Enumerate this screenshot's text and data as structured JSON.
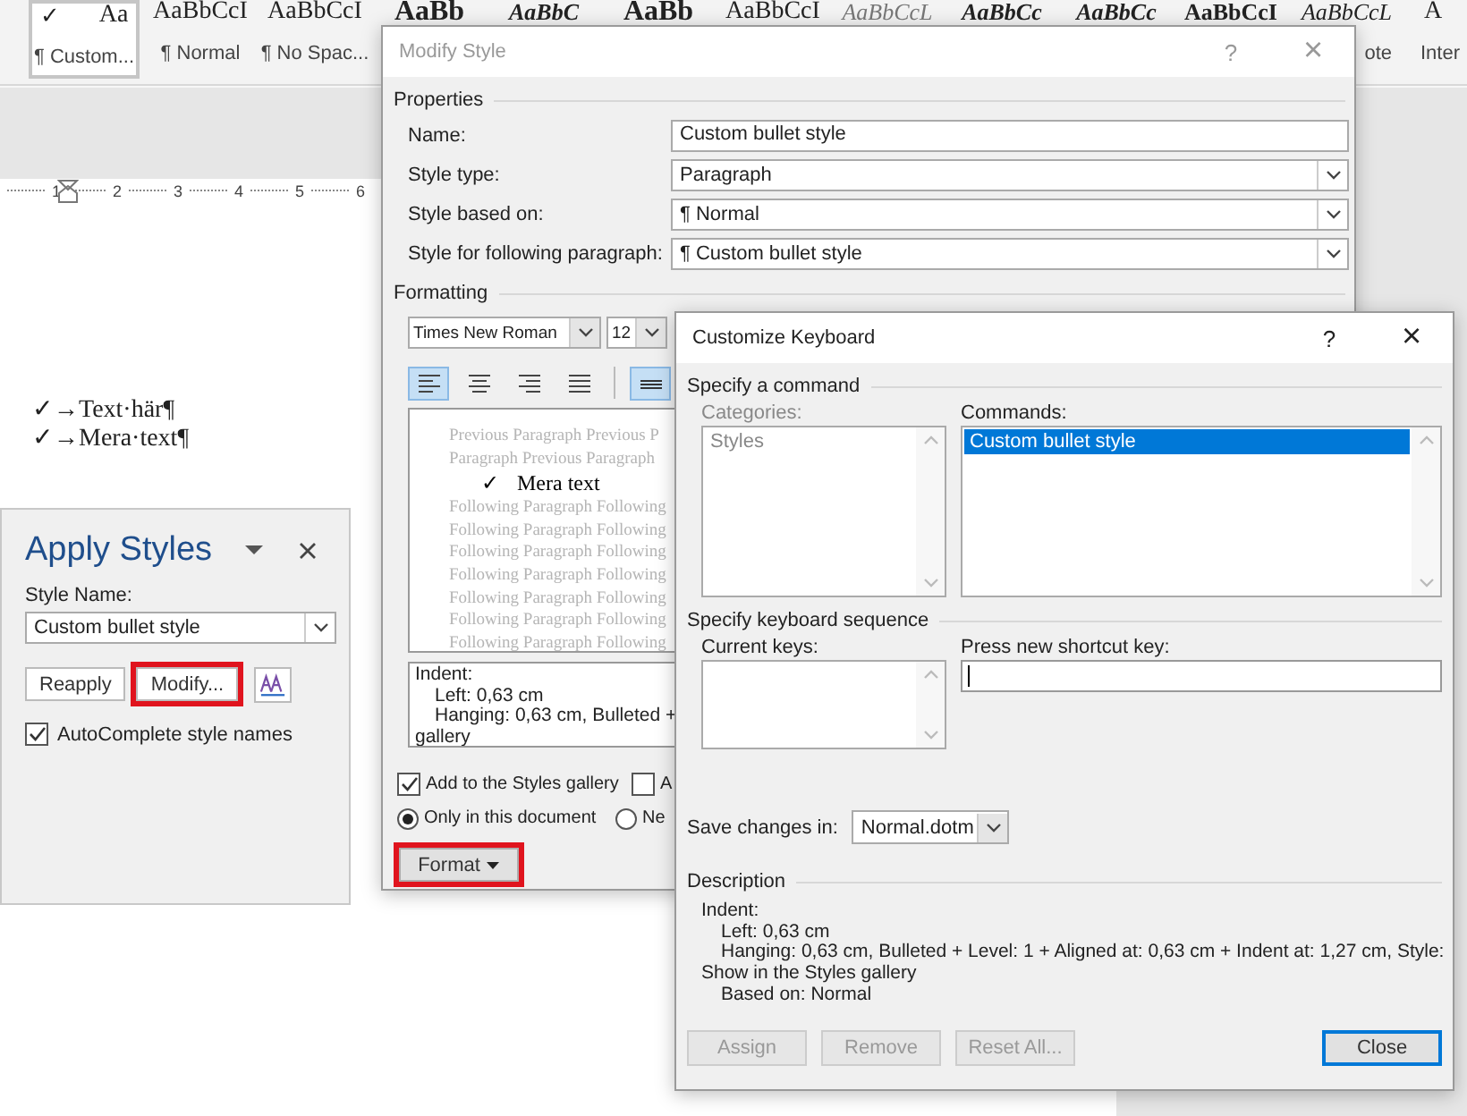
{
  "ribbon": {
    "gallery": [
      {
        "check": "✓",
        "preview": "Aa",
        "label": "¶ Custom...",
        "kind": "plain",
        "selected": true
      },
      {
        "preview": "AaBbCcI",
        "label": "¶ Normal",
        "kind": "plain",
        "selected": false
      },
      {
        "preview": "AaBbCcI",
        "label": "¶ No Spac...",
        "kind": "plain",
        "selected": false
      },
      {
        "preview": "AaBb",
        "kind": "heading",
        "selected": false
      },
      {
        "preview": "AaBbC",
        "kind": "bold-italic",
        "selected": false
      },
      {
        "preview": "AaBb",
        "kind": "heading",
        "selected": false
      },
      {
        "preview": "AaBbCcI",
        "kind": "plain",
        "selected": false
      },
      {
        "preview": "AaBbCcL",
        "kind": "subtle",
        "selected": false
      },
      {
        "preview": "AaBbCc",
        "kind": "bold-italic",
        "selected": false
      },
      {
        "preview": "AaBbCc",
        "kind": "bold-italic",
        "selected": false
      },
      {
        "preview": "AaBbCcI",
        "kind": "bold",
        "selected": false
      },
      {
        "preview": "AaBbCcL",
        "label": "ote",
        "kind": "italic",
        "selected": false
      },
      {
        "preview": "A",
        "label": "Inter",
        "kind": "plain",
        "selected": false
      }
    ]
  },
  "ruler": {
    "numbers": [
      "1",
      "2",
      "3",
      "4",
      "5",
      "6"
    ]
  },
  "document": {
    "lines": [
      "✓→Text·här¶",
      "✓→Mera·text¶"
    ]
  },
  "apply_styles": {
    "title": "Apply Styles",
    "style_name_label": "Style Name:",
    "style_name": "Custom bullet style",
    "buttons": [
      {
        "label": "Reapply",
        "highlighted": false
      },
      {
        "label": "Modify...",
        "highlighted": true
      }
    ],
    "autocomplete": {
      "label": "AutoComplete style names",
      "checked": true
    }
  },
  "modify_style": {
    "title": "Modify Style",
    "help": "?",
    "close": "×",
    "properties_label": "Properties",
    "properties": [
      {
        "label": "Name:",
        "value": "Custom bullet style",
        "kind": "text"
      },
      {
        "label": "Style type:",
        "value": "Paragraph",
        "kind": "dropdown"
      },
      {
        "label": "Style based on:",
        "value": "¶  Normal",
        "kind": "dropdown"
      },
      {
        "label": "Style for following paragraph:",
        "value": "¶  Custom bullet style",
        "kind": "dropdown"
      }
    ],
    "formatting_label": "Formatting",
    "font": "Times New Roman",
    "size": "12",
    "alignment": [
      {
        "kind": "left",
        "selected": true
      },
      {
        "kind": "center",
        "selected": false
      },
      {
        "kind": "right",
        "selected": false
      },
      {
        "kind": "justify",
        "selected": false
      },
      {
        "kind": "spacing",
        "selected": true
      }
    ],
    "preview": {
      "before": [
        "Previous Paragraph Previous P",
        "Paragraph Previous Paragraph"
      ],
      "bullet": "✓",
      "text": "Mera text",
      "after": [
        "Following Paragraph Following",
        "Following Paragraph Following",
        "Following Paragraph Following",
        "Following Paragraph Following",
        "Following Paragraph Following",
        "Following Paragraph Following",
        "Following Paragraph Following"
      ]
    },
    "description": [
      "Indent:",
      "Left:  0,63 cm",
      "Hanging:  0,63 cm, Bulleted +",
      "gallery"
    ],
    "checkboxes": [
      {
        "label": "Add to the Styles gallery",
        "checked": true
      },
      {
        "label": "A",
        "checked": false
      }
    ],
    "radios": [
      {
        "label": "Only in this document",
        "selected": true
      },
      {
        "label": "Ne",
        "selected": false
      }
    ],
    "format_button": {
      "label": "Format",
      "highlighted": true
    }
  },
  "customize_keyboard": {
    "title": "Customize Keyboard",
    "help": "?",
    "close": "×",
    "command_label": "Specify a command",
    "categories_label": "Categories:",
    "categories": [
      {
        "label": "Styles",
        "selected": false
      }
    ],
    "commands_label": "Commands:",
    "commands": [
      {
        "label": "Custom bullet style",
        "selected": true
      }
    ],
    "sequence_label": "Specify keyboard sequence",
    "current_keys_label": "Current keys:",
    "new_key_label": "Press new shortcut key:",
    "save_label": "Save changes in:",
    "save_in": "Normal.dotm",
    "description_label": "Description",
    "description": [
      "Indent:",
      "Left:  0,63 cm",
      "Hanging:  0,63 cm, Bulleted + Level: 1 + Aligned at:  0,63 cm + Indent at:  1,27 cm, Style:",
      "Show in the Styles gallery",
      "Based on: Normal"
    ],
    "buttons": [
      {
        "label": "Assign",
        "disabled": true,
        "default": false
      },
      {
        "label": "Remove",
        "disabled": true,
        "default": false
      },
      {
        "label": "Reset All...",
        "disabled": true,
        "default": false
      },
      {
        "label": "Close",
        "disabled": false,
        "default": true
      }
    ]
  }
}
